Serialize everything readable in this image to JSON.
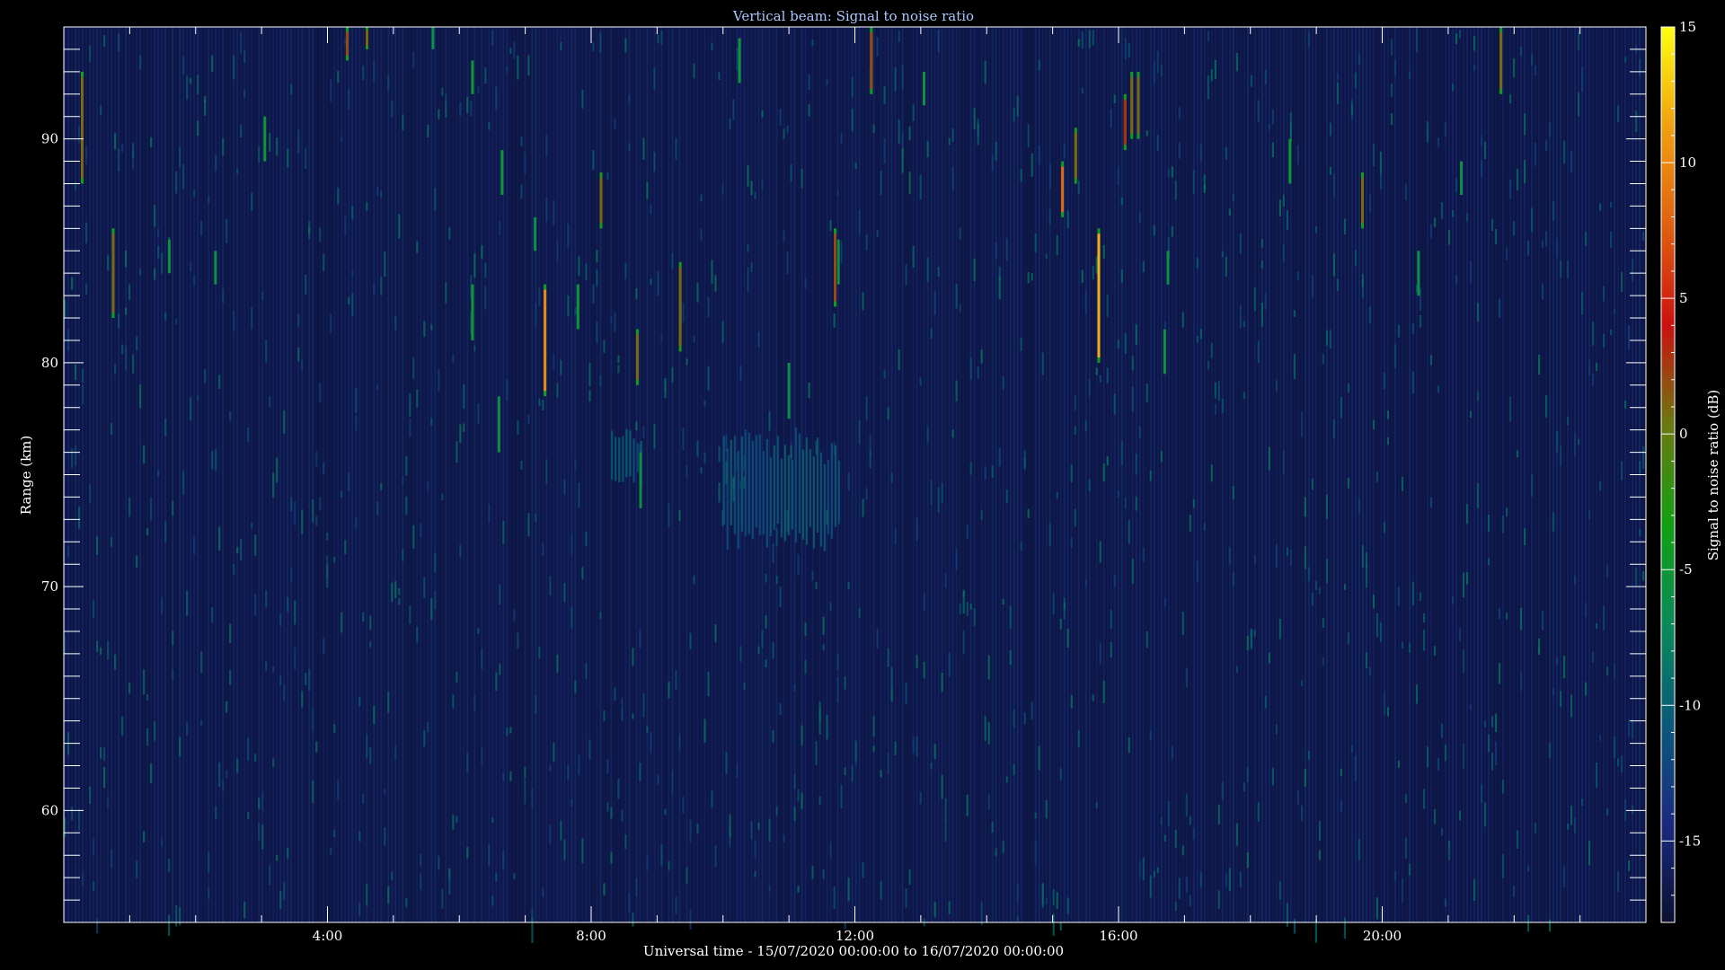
{
  "chart_data": {
    "type": "heatmap",
    "title": "Vertical beam: Signal to noise ratio",
    "xlabel": "Universal time - 15/07/2020 00:00:00 to 16/07/2020 00:00:00",
    "ylabel": "Range (km)",
    "colorbar_label": "Signal to noise ratio (dB)",
    "xlim": [
      0,
      24
    ],
    "ylim": [
      55,
      95
    ],
    "clim": [
      -18,
      15
    ],
    "x_ticks": [
      4,
      8,
      12,
      16,
      20
    ],
    "x_tick_labels": [
      "4:00",
      "8:00",
      "12:00",
      "16:00",
      "20:00"
    ],
    "y_ticks": [
      60,
      70,
      80,
      90
    ],
    "y_tick_labels": [
      "60",
      "70",
      "80",
      "90"
    ],
    "cbar_ticks": [
      -15,
      -10,
      -5,
      0,
      5,
      10,
      15
    ],
    "cbar_tick_labels": [
      "-15",
      "-10",
      "-5",
      "0",
      "5",
      "10",
      "15"
    ],
    "colormap": [
      "#0a1030",
      "#1a2a80",
      "#0a5a7a",
      "#0a8a5a",
      "#11a011",
      "#6a7a10",
      "#cc1010",
      "#e06010",
      "#f0a010",
      "#ffff10"
    ],
    "background_noise_db": -15,
    "echoes": [
      {
        "t": 0.28,
        "r0": 88,
        "r1": 93,
        "snr": 1
      },
      {
        "t": 0.75,
        "r0": 82,
        "r1": 86,
        "snr": 1
      },
      {
        "t": 1.6,
        "r0": 84,
        "r1": 85.5,
        "snr": -6
      },
      {
        "t": 2.3,
        "r0": 83.5,
        "r1": 85,
        "snr": -6
      },
      {
        "t": 3.05,
        "r0": 89,
        "r1": 91,
        "snr": -5
      },
      {
        "t": 4.3,
        "r0": 93.5,
        "r1": 95,
        "snr": 2
      },
      {
        "t": 4.6,
        "r0": 94,
        "r1": 95,
        "snr": 1
      },
      {
        "t": 5.6,
        "r0": 94,
        "r1": 95,
        "snr": -6
      },
      {
        "t": 6.2,
        "r0": 92,
        "r1": 93.5,
        "snr": -5
      },
      {
        "t": 6.2,
        "r0": 81,
        "r1": 83.5,
        "snr": -5
      },
      {
        "t": 6.6,
        "r0": 76,
        "r1": 78.5,
        "snr": -6
      },
      {
        "t": 6.65,
        "r0": 87.5,
        "r1": 89.5,
        "snr": -5
      },
      {
        "t": 7.15,
        "r0": 85,
        "r1": 86.5,
        "snr": -6
      },
      {
        "t": 7.3,
        "r0": 78.5,
        "r1": 83.5,
        "snr": 10
      },
      {
        "t": 7.8,
        "r0": 81.5,
        "r1": 83.5,
        "snr": -5
      },
      {
        "t": 8.15,
        "r0": 86,
        "r1": 88.5,
        "snr": 1
      },
      {
        "t": 8.7,
        "r0": 79,
        "r1": 81.5,
        "snr": 1
      },
      {
        "t": 8.75,
        "r0": 73.5,
        "r1": 76,
        "snr": -6
      },
      {
        "t": 9.35,
        "r0": 80.5,
        "r1": 84.5,
        "snr": 1
      },
      {
        "t": 10.25,
        "r0": 92.5,
        "r1": 94.5,
        "snr": -5
      },
      {
        "t": 11.0,
        "r0": 77.5,
        "r1": 80,
        "snr": -6
      },
      {
        "t": 11.7,
        "r0": 82.5,
        "r1": 86,
        "snr": 2
      },
      {
        "t": 11.75,
        "r0": 83.5,
        "r1": 85.5,
        "snr": -6
      },
      {
        "t": 12.25,
        "r0": 92,
        "r1": 95,
        "snr": 2
      },
      {
        "t": 13.05,
        "r0": 91.5,
        "r1": 93,
        "snr": -6
      },
      {
        "t": 15.15,
        "r0": 86.5,
        "r1": 89,
        "snr": 8
      },
      {
        "t": 15.35,
        "r0": 88,
        "r1": 90.5,
        "snr": 1
      },
      {
        "t": 15.7,
        "r0": 80,
        "r1": 86,
        "snr": 12
      },
      {
        "t": 16.1,
        "r0": 89.5,
        "r1": 92,
        "snr": 3
      },
      {
        "t": 16.2,
        "r0": 90,
        "r1": 93,
        "snr": 1
      },
      {
        "t": 16.3,
        "r0": 90,
        "r1": 93,
        "snr": 1
      },
      {
        "t": 16.7,
        "r0": 79.5,
        "r1": 81.5,
        "snr": -6
      },
      {
        "t": 16.75,
        "r0": 83.5,
        "r1": 85,
        "snr": -6
      },
      {
        "t": 18.6,
        "r0": 88,
        "r1": 90,
        "snr": -5
      },
      {
        "t": 19.7,
        "r0": 86,
        "r1": 88.5,
        "snr": 1
      },
      {
        "t": 20.55,
        "r0": 83,
        "r1": 85,
        "snr": -6
      },
      {
        "t": 21.2,
        "r0": 87.5,
        "r1": 89,
        "snr": -6
      },
      {
        "t": 21.8,
        "r0": 92,
        "r1": 95,
        "snr": 1
      }
    ],
    "diffuse_regions": [
      {
        "t0": 8.3,
        "t1": 8.8,
        "r0": 74.5,
        "r1": 77,
        "snr": -11
      },
      {
        "t0": 10.0,
        "t1": 11.8,
        "r0": 71.5,
        "r1": 77,
        "snr": -11
      }
    ]
  }
}
